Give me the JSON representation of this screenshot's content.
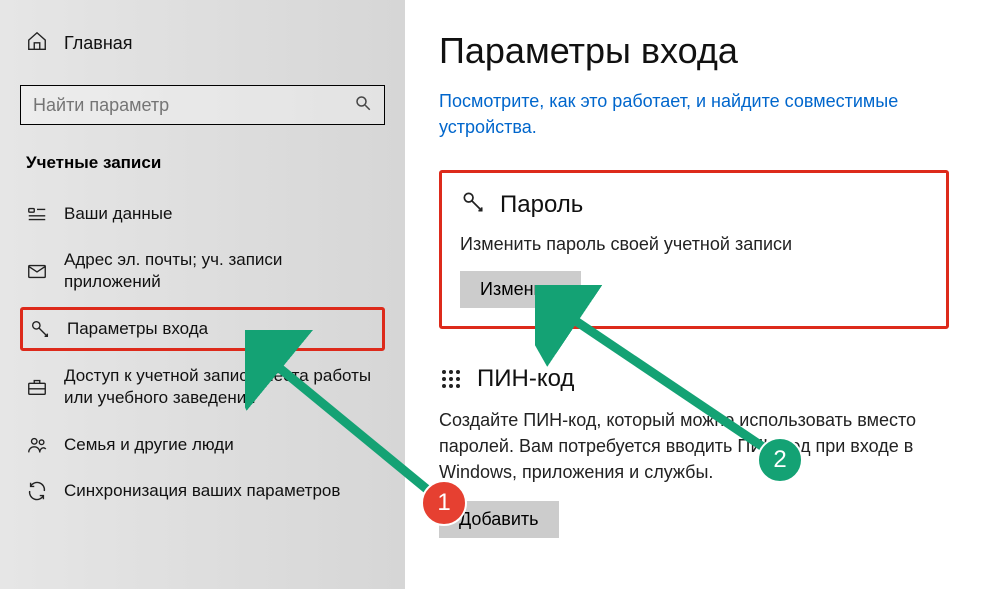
{
  "sidebar": {
    "home": "Главная",
    "search_placeholder": "Найти параметр",
    "section": "Учетные записи",
    "items": [
      {
        "label": "Ваши данные"
      },
      {
        "label": "Адрес эл. почты; уч. записи приложений"
      },
      {
        "label": "Параметры входа"
      },
      {
        "label": "Доступ к учетной записи места работы или учебного заведения"
      },
      {
        "label": "Семья и другие люди"
      },
      {
        "label": "Синхронизация ваших параметров"
      }
    ]
  },
  "main": {
    "title": "Параметры входа",
    "hint": "Посмотрите, как это работает, и найдите совместимые устройства.",
    "password": {
      "title": "Пароль",
      "desc": "Изменить пароль своей учетной записи",
      "button": "Изменить"
    },
    "pin": {
      "title": "ПИН-код",
      "desc": "Создайте ПИН-код, который можно использовать вместо паролей. Вам потребуется вводить ПИН-код при входе в Windows, приложения и службы.",
      "button": "Добавить"
    }
  },
  "markers": {
    "one": "1",
    "two": "2"
  }
}
